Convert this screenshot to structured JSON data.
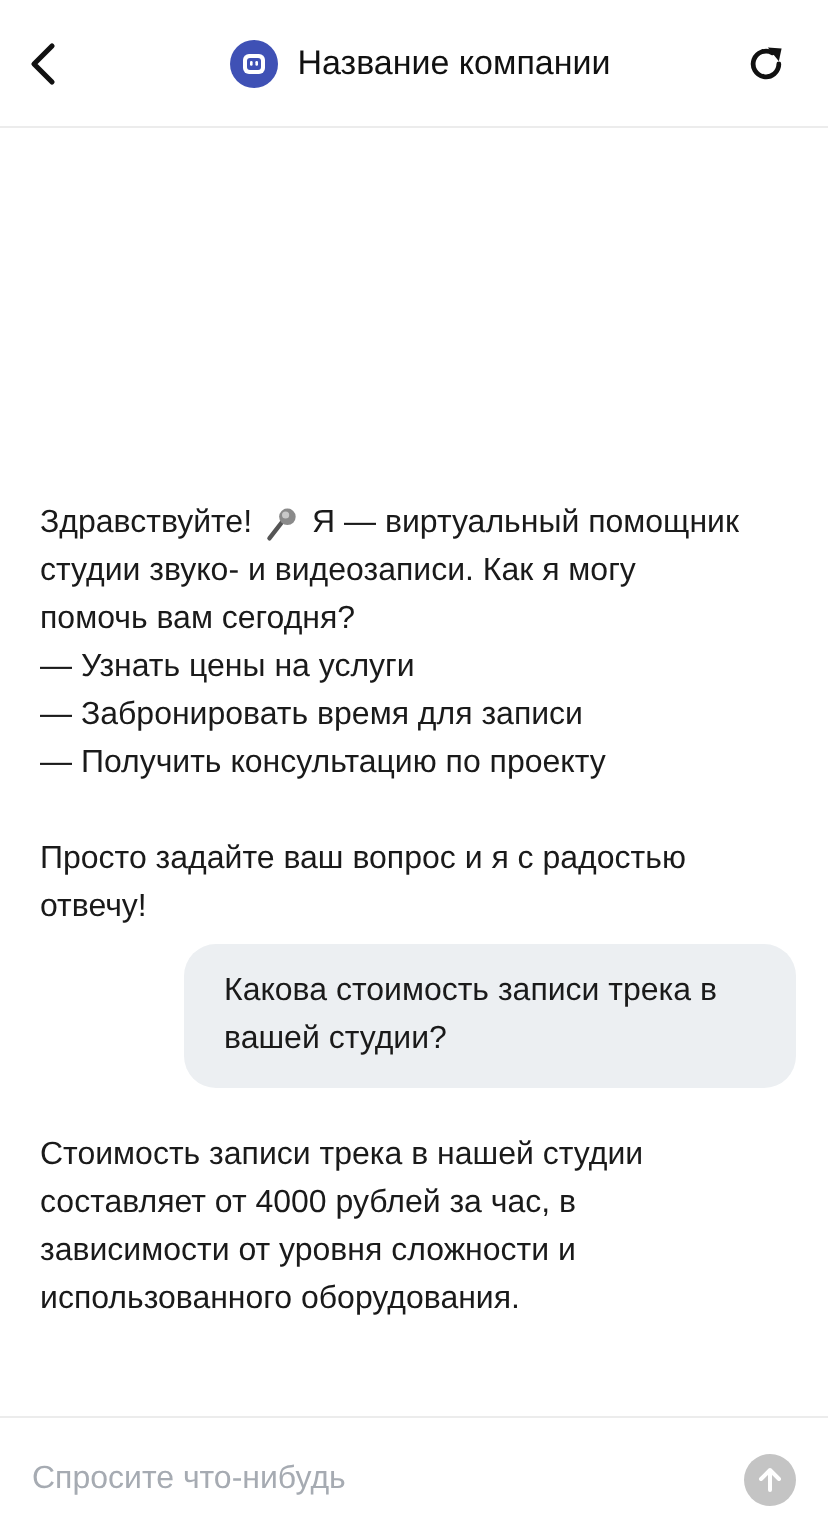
{
  "header": {
    "title": "Название компании"
  },
  "messages": [
    {
      "kind": "bot",
      "paragraphs": [
        {
          "kind": "greeting",
          "before": "Здравствуйте!",
          "after": "Я — виртуальный помощник"
        },
        {
          "kind": "paragraph",
          "text": "студии звуко- и видеозаписи. Как я могу помочь вам сегодня?"
        },
        {
          "kind": "line",
          "text": "— Узнать цены на услуги"
        },
        {
          "kind": "line",
          "text": "— Забронировать время для записи"
        },
        {
          "kind": "line",
          "text": "— Получить консультацию по проекту"
        },
        {
          "kind": "paragraph",
          "text": "Просто задайте ваш вопрос и я с радостью отвечу!"
        }
      ]
    },
    {
      "kind": "user",
      "paragraphs": [
        {
          "kind": "paragraph",
          "text": "Какова стоимость записи трека в вашей студии?"
        }
      ]
    },
    {
      "kind": "bot",
      "paragraphs": [
        {
          "kind": "paragraph",
          "text": "Стоимость записи трека в нашей студии составляет от 4000 рублей за час, в зависимости от уровня сложности и использованного оборудования."
        }
      ]
    }
  ],
  "composer": {
    "placeholder": "Спросите что-нибудь",
    "send_disabled": true
  }
}
